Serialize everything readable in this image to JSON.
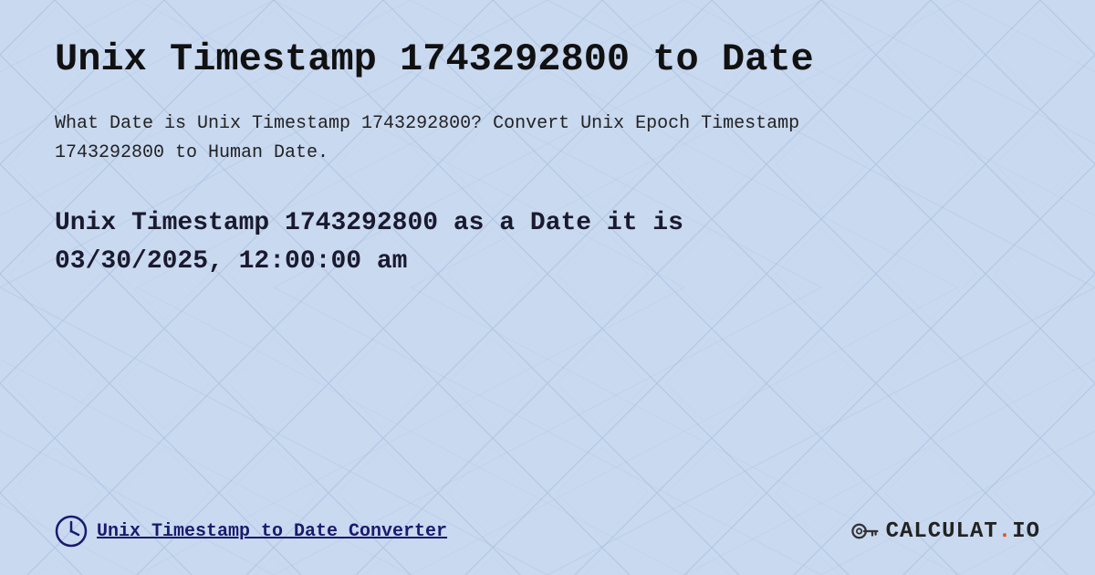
{
  "page": {
    "title": "Unix Timestamp 1743292800 to Date",
    "description": "What Date is Unix Timestamp 1743292800? Convert Unix Epoch Timestamp 1743292800 to Human Date.",
    "result_line1": "Unix Timestamp 1743292800 as a Date it is",
    "result_line2": "03/30/2025, 12:00:00 am",
    "footer_link": "Unix Timestamp to Date Converter",
    "logo_text": "CALCULAT.IO",
    "background_color": "#c8d8f0",
    "accent_color": "#1a1a6e"
  }
}
